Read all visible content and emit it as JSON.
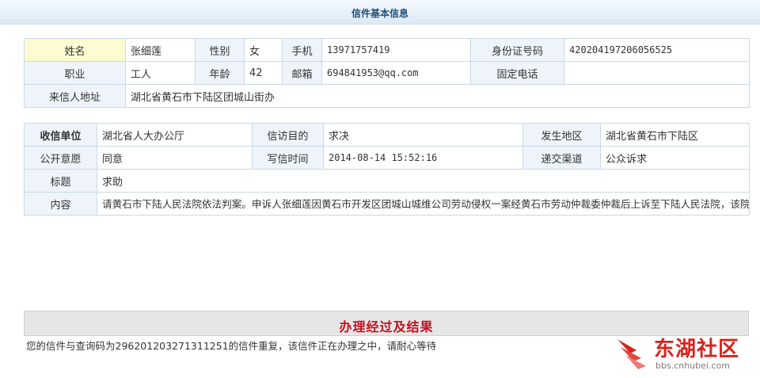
{
  "page_title": "信件基本信息",
  "sender": {
    "name_label": "姓名",
    "name": "张细莲",
    "gender_label": "性别",
    "gender": "女",
    "mobile_label": "手机",
    "mobile": "13971757419",
    "id_label": "身份证号码",
    "id_number": "420204197206056525",
    "job_label": "职业",
    "job": "工人",
    "age_label": "年龄",
    "age": "42",
    "email_label": "邮箱",
    "email": "694841953@qq.com",
    "phone_label": "固定电话",
    "phone": "",
    "address_label": "来信人地址",
    "address": "湖北省黄石市下陆区团城山街办"
  },
  "letter": {
    "recipient_label": "收信单位",
    "recipient": "湖北省人大办公厅",
    "purpose_label": "信访目的",
    "purpose": "求决",
    "region_label": "发生地区",
    "region": "湖北省黄石市下陆区",
    "public_label": "公开意愿",
    "public": "同意",
    "time_label": "写信时间",
    "time": "2014-08-14 15:52:16",
    "channel_label": "递交渠道",
    "channel": "公众诉求",
    "subject_label": "标题",
    "subject": "求助",
    "content_label": "内容",
    "content": "请黄石市下陆人民法院依法判案。申诉人张细莲因黄石市开发区团城山城维公司劳动侵权一案经黄石市劳动仲裁委仲裁后上诉至下陆人民法院，该院于2009年12月7日受理此案，并于次年3月开庭后一直拖而不决，当时本人明确表示不接受调解，要求法院依法判决。本人和我的委托人曾就此案多次找法院负责人和相关领导交涉，对方不是避而不见就是找各种理由推脱，无奈多次通过网络渠道向最高法和省市相关部门信访而无果。我听说此案之所以一直拖而不决，是因为市里给法院施加了压力，我相信这绝非空穴来风，所以这也就解释 了为什么法院敢罔顾法纪将此案一拖再拖。一晃到了2014年已是第5个年头了依然没有结案（在我之前的几个同事卫大环、秦爱民、谢珍兰的案子甚至长达10没有结案），我们在2012年给省人大去信为什么至今没有解决问题。我想问一下这个社会究竟是法治社会还是人治社会，相关部门是不是应该要有所作为。"
  },
  "result": {
    "title": "办理经过及结果",
    "text": "您的信件与查询码为296201203271311251的信件重复，该信件正在办理之中，请耐心等待"
  },
  "watermark": {
    "title": "东湖社区",
    "url": "bbs.cnhubei.com"
  },
  "colors": {
    "label_bg": "#eef4fa",
    "highlight_bg": "#fcfbd2",
    "border": "#c9d9e8",
    "result_title": "#c1121f",
    "watermark": "#d8231d"
  }
}
